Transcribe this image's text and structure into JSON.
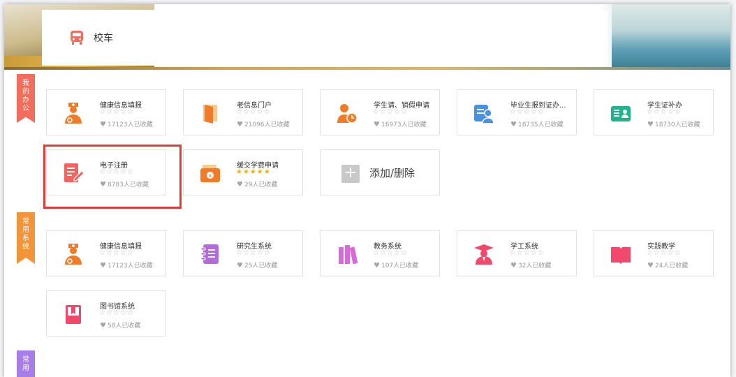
{
  "banner": {
    "bus_label": "校车"
  },
  "sections": [
    {
      "label_chars": [
        "我",
        "的",
        "办",
        "公"
      ],
      "color": "#f26d5b"
    },
    {
      "label_chars": [
        "常",
        "用",
        "系",
        "统"
      ],
      "color": "#f3943a"
    },
    {
      "label_chars": [
        "常",
        "用"
      ],
      "color": "#a77ee8"
    }
  ],
  "my_office": [
    {
      "name": "健康信息填报",
      "stars": "☆☆☆☆☆",
      "count": "17123人已收藏",
      "icon": "doctor-icon"
    },
    {
      "name": "老信息门户",
      "stars": "☆☆☆☆☆",
      "count": "21096人已收藏",
      "icon": "door-icon"
    },
    {
      "name": "学生请、销假申请",
      "stars": "☆☆☆☆☆",
      "count": "16973人已收藏",
      "icon": "person-clock-icon"
    },
    {
      "name": "毕业生报到证办...",
      "stars": "☆☆☆☆☆",
      "count": "18735人已收藏",
      "icon": "id-card-person-icon"
    },
    {
      "name": "学生证补办",
      "stars": "☆☆☆☆☆",
      "count": "18730人已收藏",
      "icon": "student-card-icon"
    },
    {
      "name": "电子注册",
      "stars": "☆☆☆☆☆",
      "count": "8783人已收藏",
      "icon": "edit-document-icon"
    },
    {
      "name": "缓交学费申请",
      "stars": "★★★★★",
      "count": "29人已收藏",
      "icon": "wallet-icon"
    }
  ],
  "add_card": {
    "label": "添加/删除",
    "plus": "+"
  },
  "common_systems": [
    {
      "name": "健康信息填报",
      "stars": "☆☆☆☆☆",
      "count": "17123人已收藏",
      "icon": "doctor-icon"
    },
    {
      "name": "研究生系统",
      "stars": "☆☆☆☆☆",
      "count": "25人已收藏",
      "icon": "notebook-icon"
    },
    {
      "name": "教务系统",
      "stars": "☆☆☆☆☆",
      "count": "107人已收藏",
      "icon": "books-icon"
    },
    {
      "name": "学工系统",
      "stars": "☆☆☆☆☆",
      "count": "32人已收藏",
      "icon": "graduate-icon"
    },
    {
      "name": "实践教学",
      "stars": "☆☆☆☆☆",
      "count": "24人已收藏",
      "icon": "open-book-icon"
    },
    {
      "name": "图书馆系统",
      "stars": "☆☆☆☆☆",
      "count": "58人已收藏",
      "icon": "library-book-icon"
    }
  ],
  "heart": "♥",
  "colors": {
    "highlight": "#e53935",
    "orange": "#f07c2a",
    "gold_star": "#f4b400"
  }
}
